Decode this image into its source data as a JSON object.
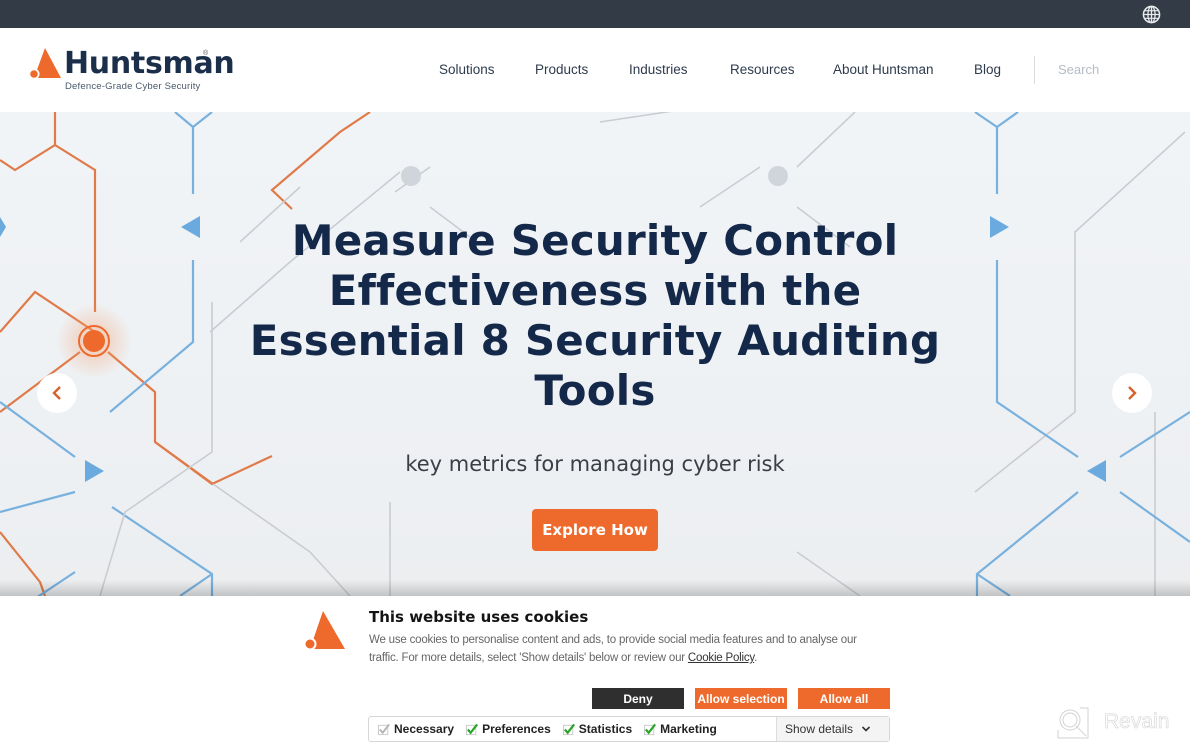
{
  "topbar": {
    "language_icon": "globe-icon"
  },
  "header": {
    "logo": {
      "name": "Huntsman",
      "registered": "®",
      "tagline": "Defence-Grade Cyber Security"
    },
    "nav": [
      {
        "label": "Solutions"
      },
      {
        "label": "Products"
      },
      {
        "label": "Industries"
      },
      {
        "label": "Resources"
      },
      {
        "label": "About Huntsman"
      },
      {
        "label": "Blog"
      }
    ],
    "search": {
      "placeholder": "Search",
      "value": ""
    }
  },
  "hero": {
    "title_lines": [
      "Measure Security Control",
      "Effectiveness with the",
      "Essential 8 Security Auditing",
      "Tools"
    ],
    "subtitle": "key metrics for managing cyber risk",
    "cta_label": "Explore How",
    "prev_icon": "chevron-left-icon",
    "next_icon": "chevron-right-icon"
  },
  "cookie_banner": {
    "title": "This website uses cookies",
    "text_before_link": "We use cookies to personalise content and ads, to provide social media features and to analyse our traffic. For more details, select 'Show details' below or review our ",
    "link_label": "Cookie Policy",
    "text_after_link": ".",
    "buttons": {
      "deny": "Deny",
      "allow_selection": "Allow selection",
      "allow_all": "Allow all"
    },
    "checkboxes": [
      {
        "label": "Necessary",
        "checked": true,
        "disabled": true
      },
      {
        "label": "Preferences",
        "checked": true,
        "disabled": false
      },
      {
        "label": "Statistics",
        "checked": true,
        "disabled": false
      },
      {
        "label": "Marketing",
        "checked": true,
        "disabled": false
      }
    ],
    "show_details_label": "Show details"
  },
  "watermark": {
    "label": "Revain"
  },
  "colors": {
    "brand_orange": "#ee6a2c",
    "navy": "#14284a",
    "topbar": "#323b46",
    "check_green": "#2aa52a"
  }
}
